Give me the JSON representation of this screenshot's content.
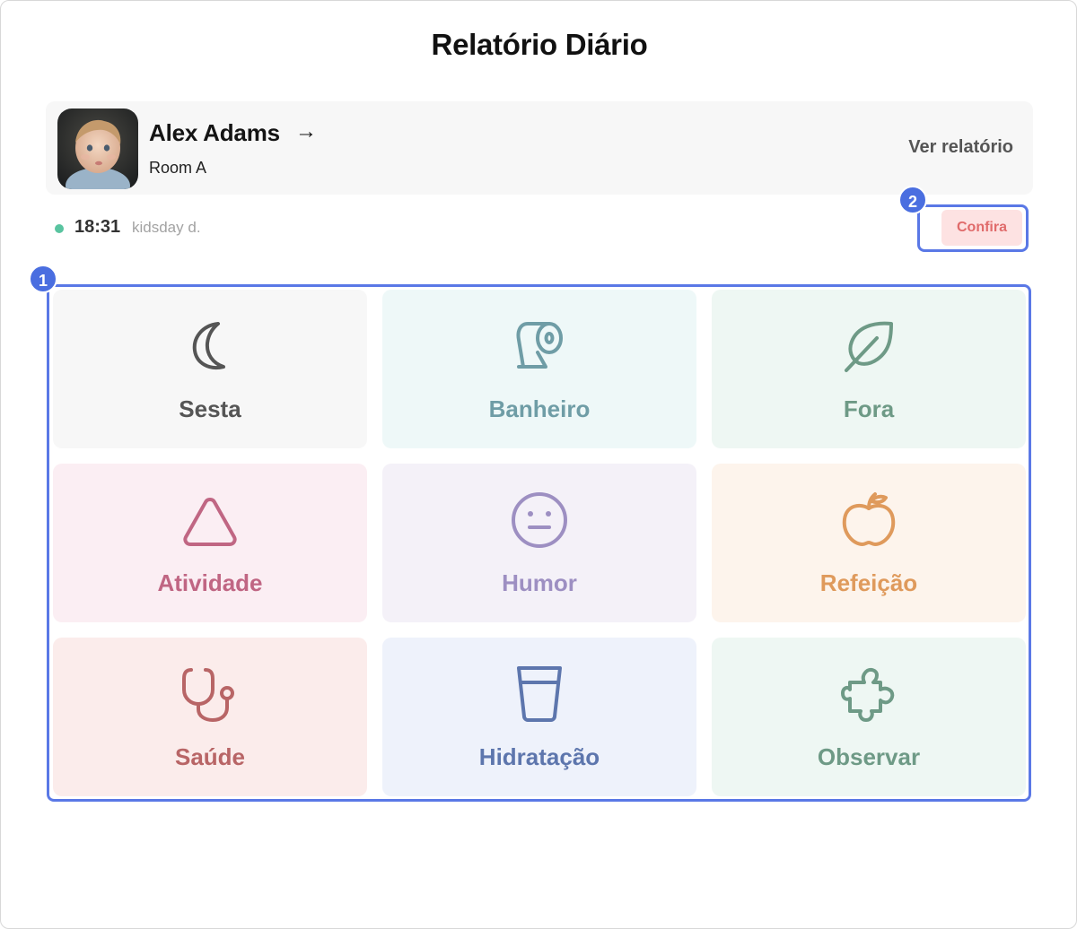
{
  "page": {
    "title": "Relatório Diário"
  },
  "child": {
    "name": "Alex Adams",
    "arrow": "→",
    "room": "Room A",
    "view_report": "Ver relatório"
  },
  "status": {
    "time": "18:31",
    "source": "kidsday d.",
    "dot_color": "#59c4a0"
  },
  "confirm_button": {
    "label": "Confira",
    "bg": "#fde2e2",
    "color": "#e06b6b"
  },
  "annotations": [
    {
      "number": "1"
    },
    {
      "number": "2"
    }
  ],
  "tiles": [
    {
      "label": "Sesta",
      "icon": "moon-icon",
      "bg": "#f7f7f7",
      "color": "#555555"
    },
    {
      "label": "Banheiro",
      "icon": "toilet-paper-icon",
      "bg": "#eef8f8",
      "color": "#6f9da6"
    },
    {
      "label": "Fora",
      "icon": "leaf-icon",
      "bg": "#eef7f3",
      "color": "#6e9a86"
    },
    {
      "label": "Atividade",
      "icon": "triangle-icon",
      "bg": "#fbeef3",
      "color": "#c06683"
    },
    {
      "label": "Humor",
      "icon": "neutral-face-icon",
      "bg": "#f4f1f8",
      "color": "#9d8fc2"
    },
    {
      "label": "Refeição",
      "icon": "apple-icon",
      "bg": "#fdf4ec",
      "color": "#df9a5c"
    },
    {
      "label": "Saúde",
      "icon": "stethoscope-icon",
      "bg": "#fbeceb",
      "color": "#b86566"
    },
    {
      "label": "Hidratação",
      "icon": "glass-icon",
      "bg": "#eef2fb",
      "color": "#5d76ad"
    },
    {
      "label": "Observar",
      "icon": "puzzle-icon",
      "bg": "#eef7f3",
      "color": "#6e9a86"
    }
  ]
}
